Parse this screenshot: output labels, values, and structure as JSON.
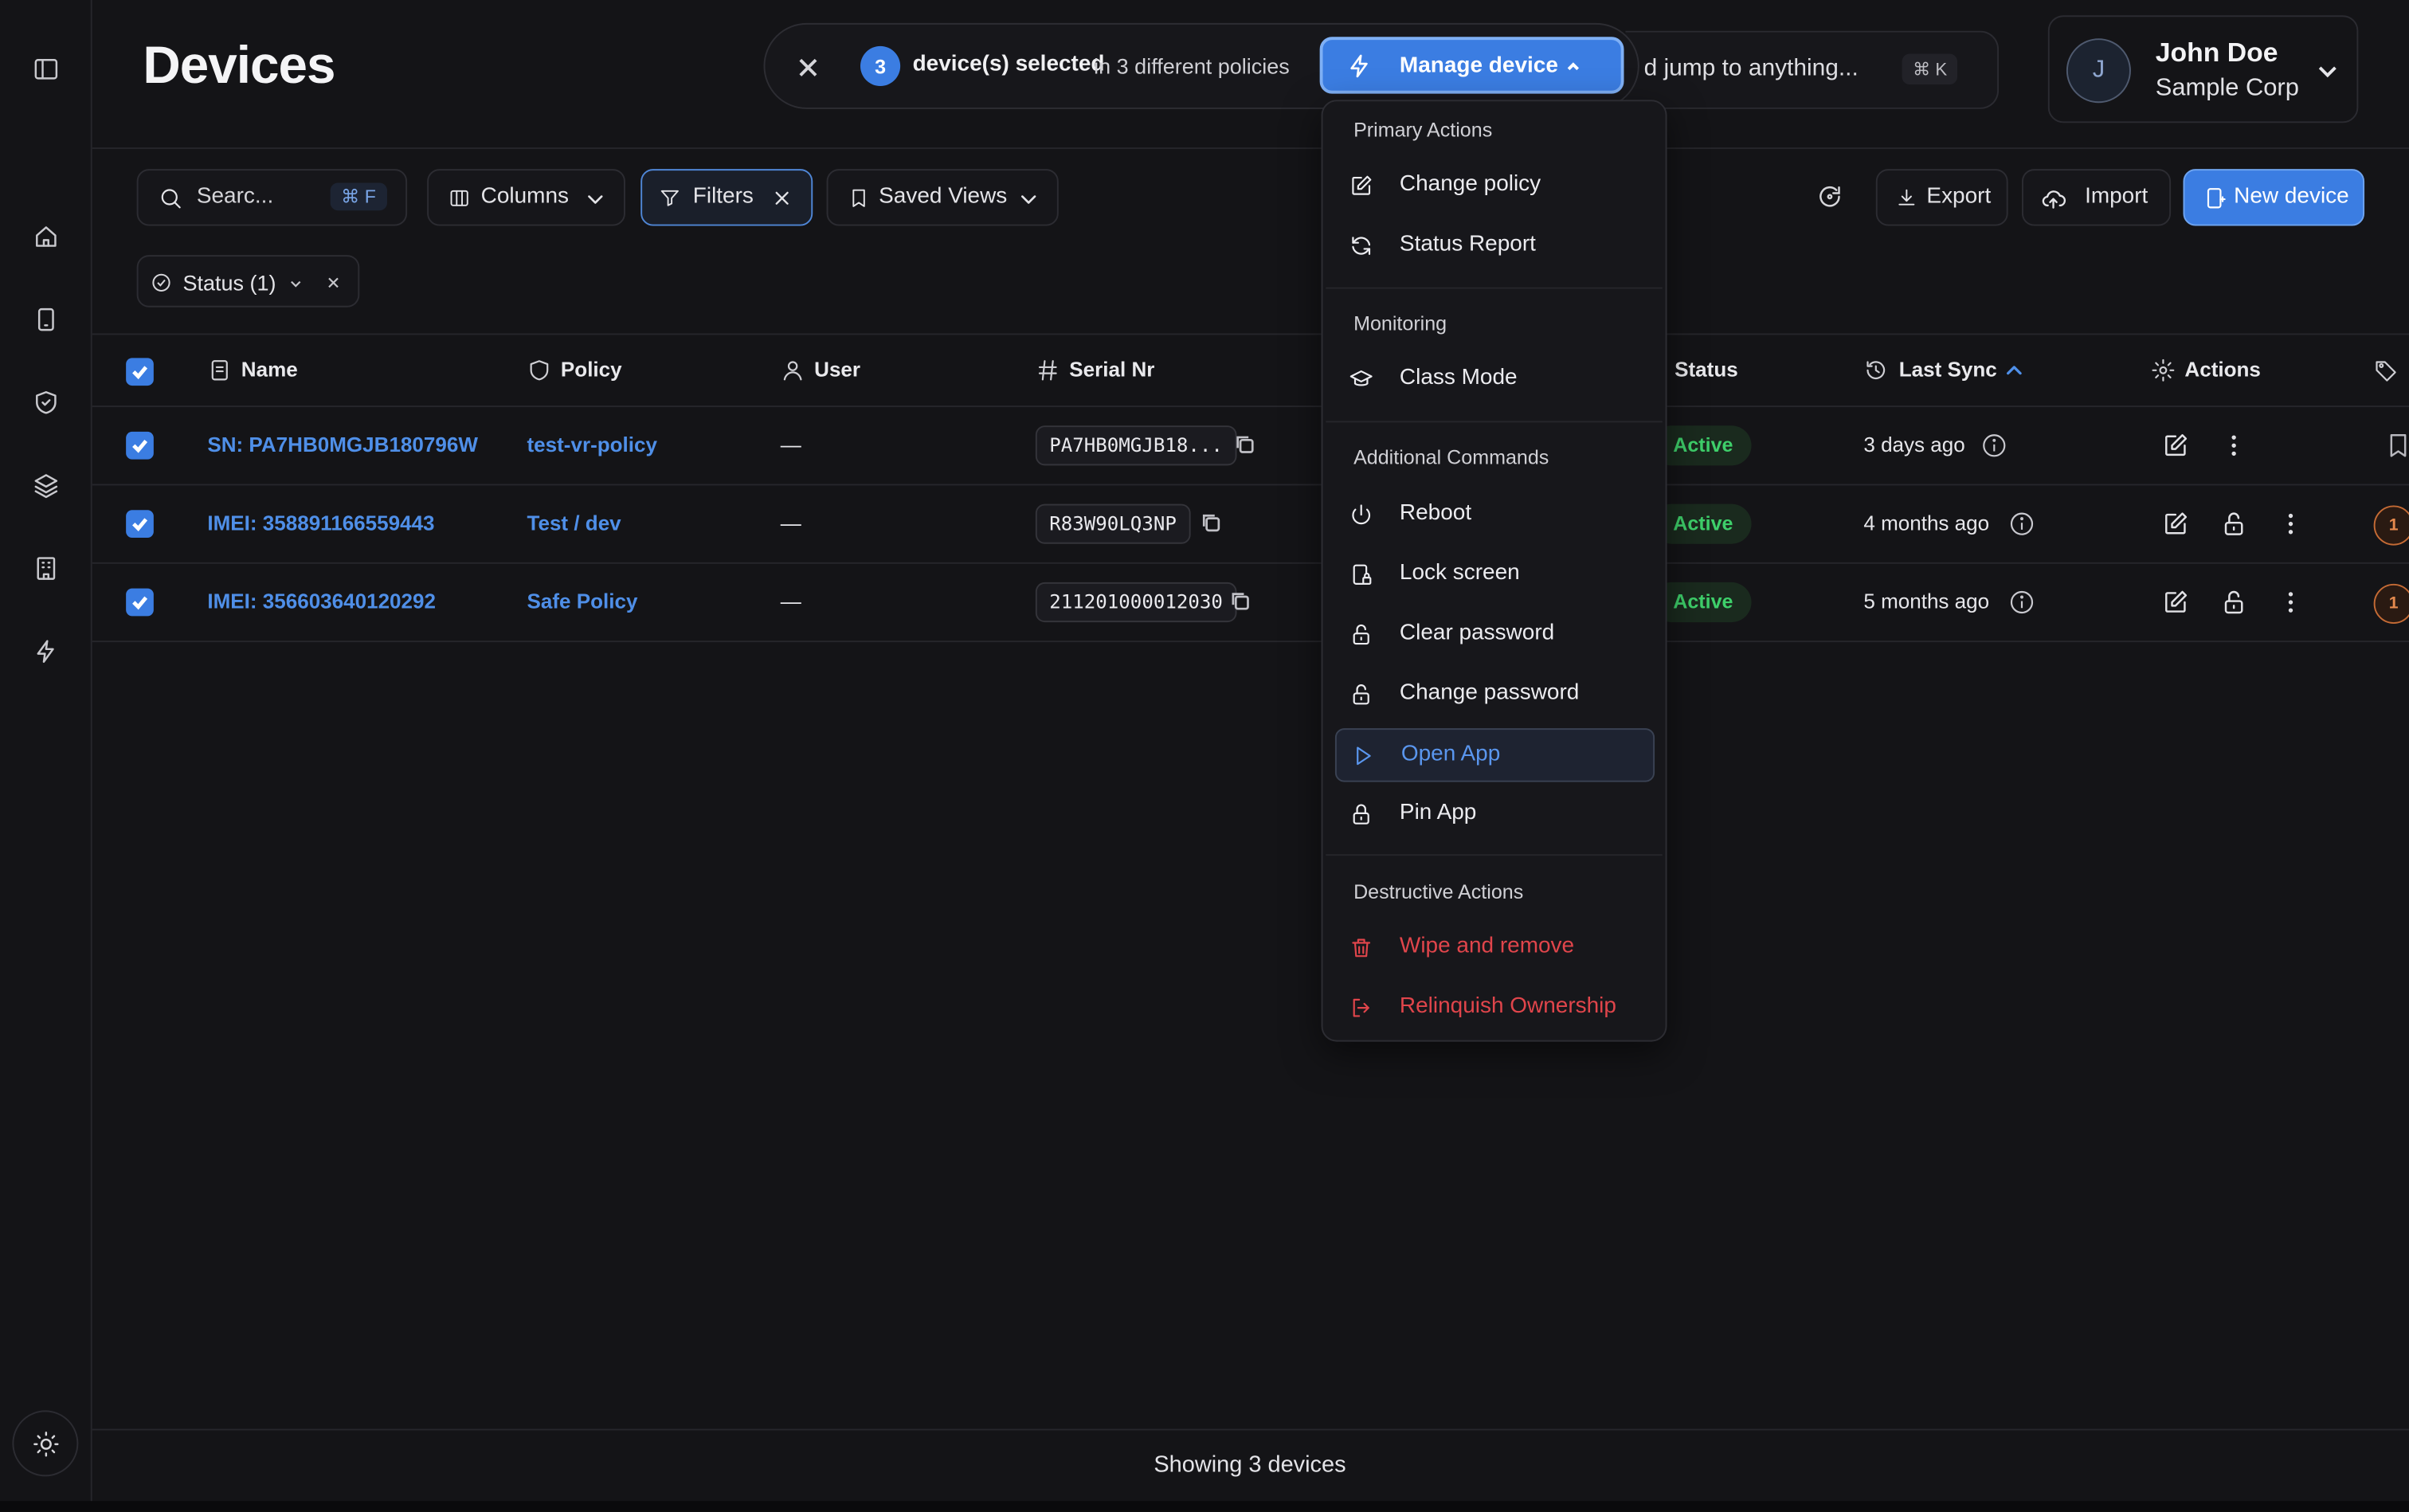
{
  "header": {
    "title": "Devices"
  },
  "selection": {
    "count": "3",
    "label": "device(s) selected",
    "sub": "in 3 different policies",
    "manage_label": "Manage device"
  },
  "jump": {
    "text": "d jump to anything...",
    "shortcut": "⌘ K"
  },
  "user": {
    "initial": "J",
    "name": "John Doe",
    "org": "Sample Corp"
  },
  "toolbar": {
    "search_placeholder": "Searc...",
    "search_shortcut": "⌘ F",
    "columns_label": "Columns",
    "filters_label": "Filters",
    "saved_views_label": "Saved Views",
    "export_label": "Export",
    "import_label": "Import",
    "new_device_label": "New device"
  },
  "filter_chip": {
    "label": "Status (1)"
  },
  "table": {
    "columns": [
      "Name",
      "Policy",
      "User",
      "Serial Nr",
      "Status",
      "Last Sync",
      "Actions"
    ],
    "rows": [
      {
        "name": "SN: PA7HB0MGJB180796W",
        "policy": "test-vr-policy",
        "user": "—",
        "serial": "PA7HB0MGJB18...",
        "status": "Active",
        "last_sync": "3 days ago",
        "tag_count": ""
      },
      {
        "name": "IMEI: 358891166559443",
        "policy": "Test / dev",
        "user": "—",
        "serial": "R83W90LQ3NP",
        "status": "Active",
        "last_sync": "4 months ago",
        "tag_count": "1"
      },
      {
        "name": "IMEI: 356603640120292",
        "policy": "Safe Policy",
        "user": "—",
        "serial": "211201000012030",
        "status": "Active",
        "last_sync": "5 months ago",
        "tag_count": "1"
      }
    ]
  },
  "menu": {
    "sections": [
      {
        "title": "Primary Actions",
        "items": [
          "Change policy",
          "Status Report"
        ]
      },
      {
        "title": "Monitoring",
        "items": [
          "Class Mode"
        ]
      },
      {
        "title": "Additional Commands",
        "items": [
          "Reboot",
          "Lock screen",
          "Clear password",
          "Change password",
          "Open App",
          "Pin App"
        ]
      },
      {
        "title": "Destructive Actions",
        "items": [
          "Wipe and remove",
          "Relinquish Ownership"
        ]
      }
    ]
  },
  "footer": {
    "text": "Showing 3 devices"
  },
  "colors": {
    "accent": "#3b7de2",
    "link": "#4f8fe8",
    "success": "#3ecf6a",
    "danger": "#e0454b",
    "tag": "#e58a4e",
    "background": "#141417"
  }
}
